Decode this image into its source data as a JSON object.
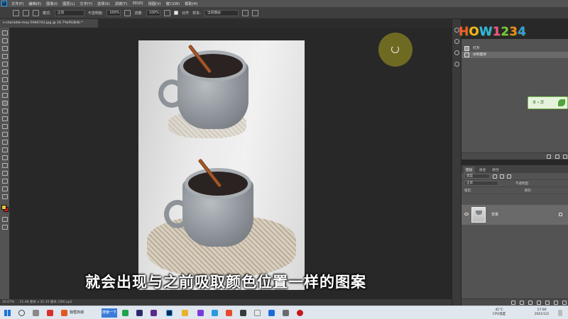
{
  "menu": {
    "app_icon": "Ps",
    "items": [
      "文件(F)",
      "编辑(E)",
      "图像(I)",
      "图层(L)",
      "文字(Y)",
      "选择(S)",
      "滤镜(T)",
      "3D(D)",
      "视图(V)",
      "窗口(W)",
      "帮助(H)"
    ]
  },
  "options": {
    "mode_label": "模式:",
    "mode_value": "正常",
    "opacity_label": "不透明度:",
    "opacity_value": "100%",
    "flow_label": "流量:",
    "flow_value": "100%",
    "aligned_label": "对齐",
    "sample_label": "样本:",
    "sample_value": "当前图层"
  },
  "document": {
    "tab_title": "s-charlotte-may-5946743.jpg @ 16.7%(RGB/8) *"
  },
  "subtitle": "就会出现与之前吸取颜色位置一样的图案",
  "status": {
    "zoom": "16.67%",
    "size": "21.48 厘米 x 32.35 厘米 (300 ppi)"
  },
  "history_panel": {
    "rows": [
      "打开",
      "仿制图章"
    ]
  },
  "layers_panel": {
    "tabs": [
      "图层",
      "通道",
      "路径"
    ],
    "kind_placeholder": "类型",
    "blend_mode": "正常",
    "opacity_label": "不透明度:",
    "lock_label": "锁定:",
    "fill_label": "填充:",
    "layer_name": "背景"
  },
  "logo": {
    "text": [
      "H",
      "O",
      "W",
      "1",
      "2",
      "3",
      "4"
    ],
    "colors": [
      "#ff5a2a",
      "#ffb21c",
      "#35b6e8",
      "#ff4f8b",
      "#7fc63a",
      "#ff8a1c",
      "#3f9be0"
    ]
  },
  "badge": {
    "text": "率 • 屏"
  },
  "taskbar": {
    "browser_label": "我框商城",
    "search_button": "搜索一下",
    "weather_temp": "41°C",
    "weather_label": "CPU温度",
    "time": "17:00",
    "date": "2021/1/2"
  }
}
